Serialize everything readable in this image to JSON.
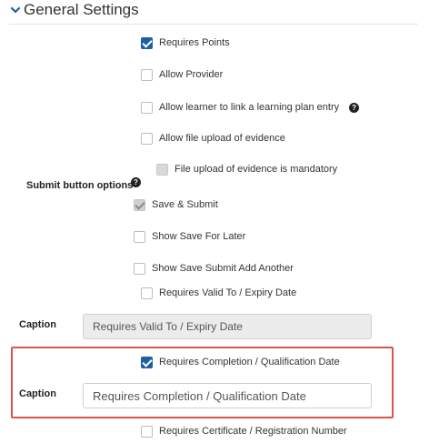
{
  "section": {
    "title": "General Settings",
    "icon": "chevron-down-icon"
  },
  "options": {
    "requires_points": "Requires Points",
    "allow_provider": "Allow Provider",
    "allow_learner_link": "Allow learner to link a learning plan entry",
    "allow_file_upload": "Allow file upload of evidence",
    "file_upload_mandatory": "File upload of evidence is mandatory"
  },
  "submit_options": {
    "label": "Submit button options",
    "save_submit": "Save & Submit",
    "show_save_later": "Show Save For Later",
    "show_save_submit_add": "Show Save Submit Add Another"
  },
  "valid_to": {
    "label": "Requires Valid To / Expiry Date",
    "caption_label": "Caption",
    "caption_value": "Requires Valid To / Expiry Date"
  },
  "completion": {
    "label": "Requires Completion / Qualification Date",
    "caption_label": "Caption",
    "caption_value": "Requires Completion / Qualification Date"
  },
  "certificate": {
    "label": "Requires Certificate / Registration Number"
  },
  "help_glyph": "?",
  "colors": {
    "accent": "#1f5fa5",
    "highlight": "#d9534f"
  }
}
